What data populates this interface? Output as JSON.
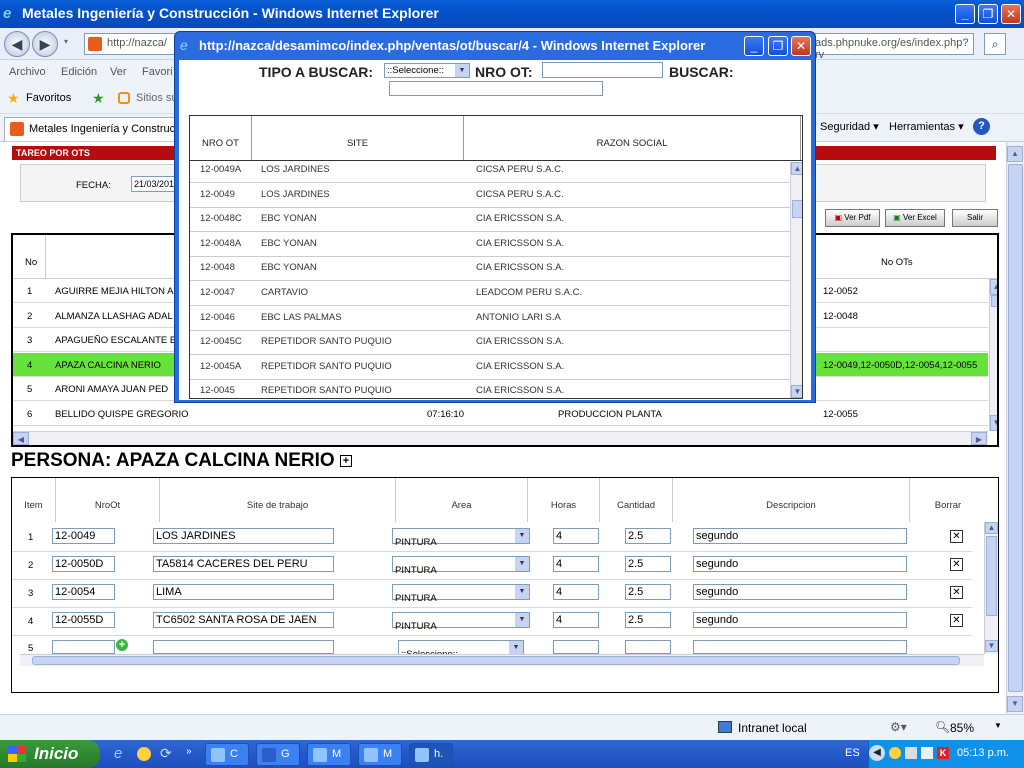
{
  "window": {
    "title": "Metales Ingeniería y Construcción - Windows Internet Explorer",
    "url": "http://nazca/",
    "url_right": "ads.phpnuke.org/es/index.php?rv"
  },
  "menu": {
    "archivo": "Archivo",
    "edicion": "Edición",
    "ver": "Ver",
    "favoritos": "Favori"
  },
  "favbar": {
    "favoritos": "Favoritos",
    "sitios": "Sitios su"
  },
  "tabbar": {
    "tab_label": "Metales Ingeniería y Construc",
    "seguridad": "Seguridad ▾",
    "herramientas": "Herramientas ▾",
    "help": "?"
  },
  "page": {
    "section_title": "TAREO POR OTS",
    "fecha_label": "FECHA:",
    "fecha_value": "21/03/201",
    "ver_pdf": "Ver Pdf",
    "ver_excel": "Ver Excel",
    "salir": "Salir"
  },
  "workers_table": {
    "headers": {
      "no": "No",
      "no_ots": "No OTs"
    },
    "rows": [
      {
        "no": "1",
        "name": "AGUIRRE MEJIA HILTON A",
        "time": "",
        "area": "",
        "ots": "12-0052"
      },
      {
        "no": "2",
        "name": "ALMANZA LLASHAG ADAL",
        "time": "",
        "area": "",
        "ots": "12-0048"
      },
      {
        "no": "3",
        "name": "APAGUEÑO ESCALANTE E",
        "time": "",
        "area": "",
        "ots": ""
      },
      {
        "no": "4",
        "name": "APAZA CALCINA NERIO",
        "time": "",
        "area": "",
        "ots": "12-0049,12-0050D,12-0054,12-0055"
      },
      {
        "no": "5",
        "name": "ARONI AMAYA JUAN PED",
        "time": "",
        "area": "",
        "ots": ""
      },
      {
        "no": "6",
        "name": "BELLIDO QUISPE GREGORIO",
        "time": "07:16:10",
        "area": "PRODUCCION PLANTA",
        "ots": "12-0055"
      }
    ]
  },
  "persona": {
    "title": "PERSONA: APAZA CALCINA NERIO",
    "expand": "+"
  },
  "detail_table": {
    "headers": {
      "item": "Item",
      "nroot": "NroOt",
      "site": "Site de trabajo",
      "area": "Area",
      "horas": "Horas",
      "cantidad": "Cantidad",
      "descripcion": "Descripcion",
      "borrar": "Borrar"
    },
    "rows": [
      {
        "item": "1",
        "nroot": "12-0049",
        "site": "LOS JARDINES",
        "area": "PINTURA",
        "horas": "4",
        "cantidad": "2.5",
        "desc": "segundo"
      },
      {
        "item": "2",
        "nroot": "12-0050D",
        "site": "TA5814 CACERES DEL PERU",
        "area": "PINTURA",
        "horas": "4",
        "cantidad": "2.5",
        "desc": "segundo"
      },
      {
        "item": "3",
        "nroot": "12-0054",
        "site": "LIMA",
        "area": "PINTURA",
        "horas": "4",
        "cantidad": "2.5",
        "desc": "segundo"
      },
      {
        "item": "4",
        "nroot": "12-0055D",
        "site": "TC6502  SANTA ROSA DE JAEN",
        "area": "PINTURA",
        "horas": "4",
        "cantidad": "2.5",
        "desc": "segundo"
      }
    ],
    "new_row": {
      "item": "5",
      "area_placeholder": "::Seleccione::"
    }
  },
  "popup": {
    "title": "http://nazca/desamimco/index.php/ventas/ot/buscar/4 - Windows Internet Explorer",
    "tipo_label": "TIPO A BUSCAR:",
    "tipo_value": "::Seleccione::",
    "nro_label": "NRO OT:",
    "buscar_label": "BUSCAR:",
    "headers": {
      "nro": "NRO OT",
      "site": "SITE",
      "razon": "RAZON SOCIAL"
    },
    "rows": [
      {
        "nro": "12-0049A",
        "site": "LOS JARDINES",
        "razon": "CICSA PERU S.A.C."
      },
      {
        "nro": "12-0049",
        "site": "LOS JARDINES",
        "razon": "CICSA PERU S.A.C."
      },
      {
        "nro": "12-0048C",
        "site": "EBC YONAN",
        "razon": "CIA ERICSSON S.A."
      },
      {
        "nro": "12-0048A",
        "site": "EBC YONAN",
        "razon": "CIA ERICSSON S.A."
      },
      {
        "nro": "12-0048",
        "site": "EBC YONAN",
        "razon": "CIA ERICSSON S.A."
      },
      {
        "nro": "12-0047",
        "site": "CARTAVIO",
        "razon": "LEADCOM PERU S.A.C."
      },
      {
        "nro": "12-0046",
        "site": "EBC LAS PALMAS",
        "razon": "ANTONIO LARI S.A"
      },
      {
        "nro": "12-0045C",
        "site": "REPETIDOR SANTO PUQUIO",
        "razon": "CIA ERICSSON S.A."
      },
      {
        "nro": "12-0045A",
        "site": "REPETIDOR SANTO PUQUIO",
        "razon": "CIA ERICSSON S.A."
      },
      {
        "nro": "12-0045",
        "site": "REPETIDOR SANTO PUQUIO",
        "razon": "CIA ERICSSON S.A."
      }
    ]
  },
  "statusbar": {
    "zone": "Intranet local",
    "zoom": "85%"
  },
  "taskbar": {
    "start": "Inicio",
    "tasks": [
      "C",
      "G",
      "M",
      "M",
      "h."
    ],
    "lang": "ES",
    "clock": "05:13 p.m."
  },
  "colors": {
    "accent": "#b50d0d",
    "selected_row": "#66e23a",
    "ie_blue": "#0a5fd8"
  }
}
